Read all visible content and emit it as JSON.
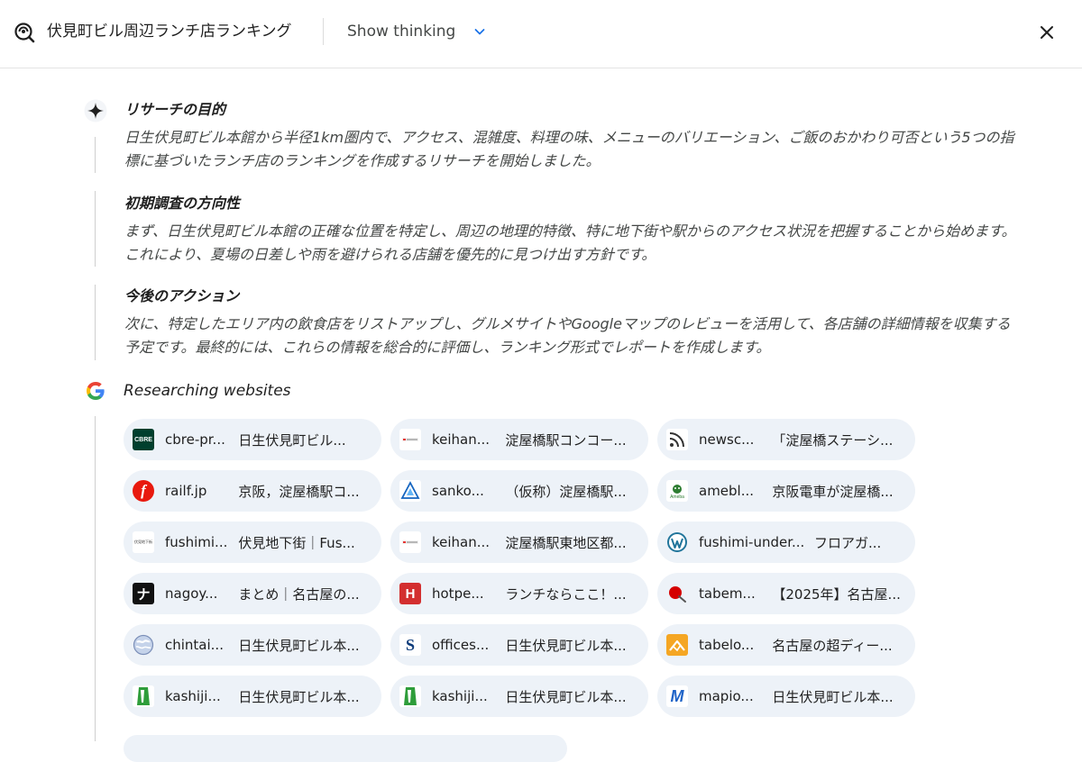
{
  "header": {
    "title": "伏見町ビル周辺ランチ店ランキング",
    "toggle_label": "Show thinking"
  },
  "sections": [
    {
      "heading": "リサーチの目的",
      "body": "日生伏見町ビル本館から半径1km圏内で、アクセス、混雑度、料理の味、メニューのバリエーション、ご飯のおかわり可否という5つの指標に基づいたランチ店のランキングを作成するリサーチを開始しました。"
    },
    {
      "heading": "初期調査の方向性",
      "body": "まず、日生伏見町ビル本館の正確な位置を特定し、周辺の地理的特徴、特に地下街や駅からのアクセス状況を把握することから始めます。これにより、夏場の日差しや雨を避けられる店舗を優先的に見つけ出す方針です。"
    },
    {
      "heading": "今後のアクション",
      "body": "次に、特定したエリア内の飲食店をリストアップし、グルメサイトやGoogleマップのレビューを活用して、各店舗の詳細情報を収集する予定です。最終的には、これらの情報を総合的に評価し、ランキング形式でレポートを作成します。"
    }
  ],
  "research": {
    "heading": "Researching websites",
    "sources": [
      {
        "domain": "cbre-pr...",
        "title": "日生伏見町ビル...",
        "icon": "cbre-logo-icon",
        "logo_text": "CBRE"
      },
      {
        "domain": "keihan...",
        "title": "淀屋橋駅コンコー...",
        "icon": "keihan-logo-icon"
      },
      {
        "domain": "newsc...",
        "title": "「淀屋橋ステーシ...",
        "icon": "rss-feed-icon"
      },
      {
        "domain": "railf.jp",
        "title": "京阪，淀屋橋駅コ...",
        "icon": "railf-logo-icon",
        "logo_text": "f"
      },
      {
        "domain": "sanko...",
        "title": "（仮称）淀屋橋駅...",
        "icon": "sanko-logo-icon"
      },
      {
        "domain": "amebl...",
        "title": "京阪電車が淀屋橋...",
        "icon": "ameba-logo-icon",
        "logo_text": "Ameba"
      },
      {
        "domain": "fushimi...",
        "title": "伏見地下街｜Fus...",
        "icon": "fushimi-chika-logo-icon",
        "logo_text": "伏見地下街"
      },
      {
        "domain": "keihan...",
        "title": "淀屋橋駅東地区都...",
        "icon": "keihan-logo-icon"
      },
      {
        "domain": "fushimi-under...",
        "title": "フロアガ...",
        "icon": "wordpress-logo-icon"
      },
      {
        "domain": "nagoy...",
        "title": "まとめ｜名古屋の...",
        "icon": "nagoya-logo-icon",
        "logo_text": "ナ"
      },
      {
        "domain": "hotpe...",
        "title": "ランチならここ！...",
        "icon": "hotpepper-logo-icon",
        "logo_text": "H"
      },
      {
        "domain": "tabem...",
        "title": "【2025年】名古屋...",
        "icon": "tabemaru-logo-icon"
      },
      {
        "domain": "chintai...",
        "title": "日生伏見町ビル本...",
        "icon": "globe-icon"
      },
      {
        "domain": "offices...",
        "title": "日生伏見町ビル本...",
        "icon": "offices-logo-icon",
        "logo_text": "S"
      },
      {
        "domain": "tabelo...",
        "title": "名古屋の超ディー...",
        "icon": "tabelog-logo-icon"
      },
      {
        "domain": "kashiji...",
        "title": "日生伏見町ビル本...",
        "icon": "kashijimusho-logo-icon"
      },
      {
        "domain": "kashiji...",
        "title": "日生伏見町ビル本...",
        "icon": "kashijimusho-logo-icon"
      },
      {
        "domain": "mapio...",
        "title": "日生伏見町ビル本...",
        "icon": "mapion-logo-icon",
        "logo_text": "M"
      }
    ]
  },
  "colors": {
    "chip_bg": "#edf2f8",
    "accent": "#1a73e8",
    "body_text": "#444746"
  }
}
